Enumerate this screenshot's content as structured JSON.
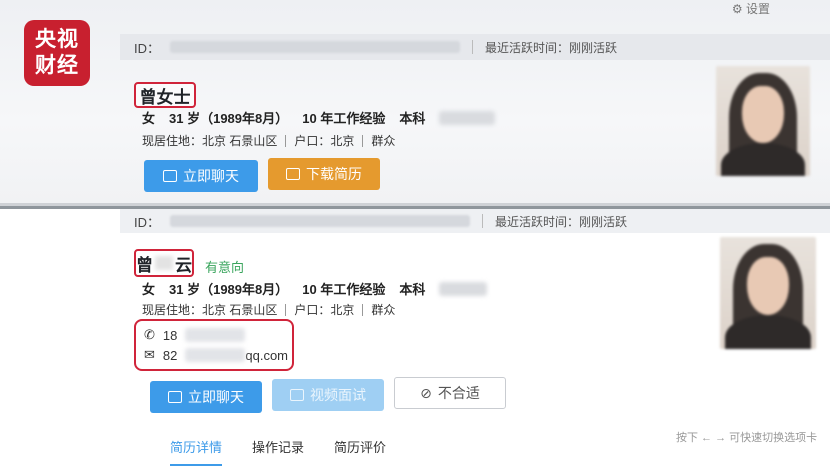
{
  "logo": {
    "line1": "央视",
    "line2": "财经"
  },
  "top": {
    "id_label": "ID：",
    "last_active_label": "最近活跃时间：刚刚活跃",
    "name": "曾女士",
    "info": {
      "gender": "女",
      "age": "31 岁（1989年8月）",
      "experience": "10 年工作经验",
      "education": "本科"
    },
    "address": {
      "residence": "现居住地：北京 石景山区",
      "hukou": "户口：北京",
      "politics": "群众"
    },
    "buttons": {
      "chat": "立即聊天",
      "download": "下载简历"
    },
    "top_right": "设置"
  },
  "bottom": {
    "id_label": "ID：",
    "last_active_label": "最近活跃时间：刚刚活跃",
    "name_first": "曾",
    "name_last": "云",
    "intent": "有意向",
    "info": {
      "gender": "女",
      "age": "31 岁（1989年8月）",
      "experience": "10 年工作经验",
      "education": "本科"
    },
    "address": {
      "residence": "现居住地：北京 石景山区",
      "hukou": "户口：北京",
      "politics": "群众"
    },
    "contact": {
      "phone_prefix": "18",
      "email_prefix": "82",
      "email_suffix": "qq.com"
    },
    "buttons": {
      "chat": "立即聊天",
      "video": "视频面试",
      "reject": "不合适"
    },
    "tabs": [
      "简历详情",
      "操作记录",
      "简历评价"
    ],
    "hint": "按下 ← → 可快速切换选项卡"
  }
}
